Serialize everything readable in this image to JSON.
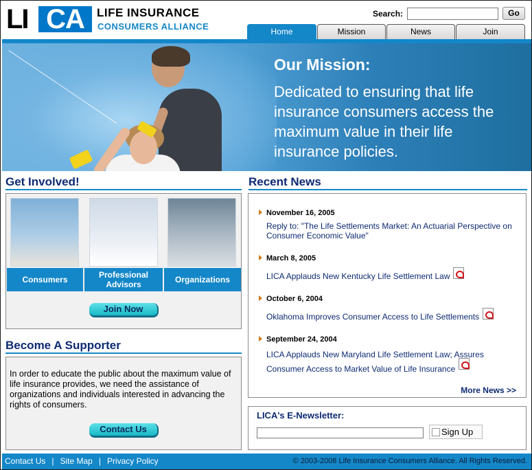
{
  "header": {
    "logo_left": "LI",
    "logo_right": "CA",
    "brand_line1": "LIFE INSURANCE",
    "brand_line2": "CONSUMERS ALLIANCE",
    "search_label": "Search:",
    "search_value": "",
    "go_label": "Go"
  },
  "tabs": [
    {
      "label": "Home",
      "active": true
    },
    {
      "label": "Mission",
      "active": false
    },
    {
      "label": "News",
      "active": false
    },
    {
      "label": "Join",
      "active": false
    }
  ],
  "hero": {
    "title": "Our Mission:",
    "text": "Dedicated to ensuring that life insurance consumers access the maximum value in their life insurance policies."
  },
  "get_involved": {
    "heading": "Get Involved!",
    "cells": [
      "Consumers",
      "Professional Advisors",
      "Organizations"
    ],
    "button": "Join Now"
  },
  "supporter": {
    "heading": "Become A Supporter",
    "text": "In order to educate the public about the maximum value of life insurance provides, we need the assistance of organizations and individuals interested in advancing the rights of consumers.",
    "button": "Contact Us"
  },
  "news": {
    "heading": "Recent News",
    "items": [
      {
        "date": "November 16, 2005",
        "title": "Reply to: \"The Life Settlements Market: An Actuarial Perspective on Consumer Economic Value\"",
        "pdf": false
      },
      {
        "date": "March 8, 2005",
        "title": "LICA Applauds New Kentucky Life Settlement Law",
        "pdf": true
      },
      {
        "date": "October 6, 2004",
        "title": "Oklahoma Improves Consumer Access to Life Settlements",
        "pdf": true
      },
      {
        "date": "September 24, 2004",
        "title": "LICA Applauds New Maryland Life Settlement Law; Assures Consumer Access to Market Value of Life Insurance",
        "pdf": true
      }
    ],
    "more": "More News >>"
  },
  "newsletter": {
    "title": "LICA's E-Newsletter:",
    "email_value": "",
    "signup": "Sign Up"
  },
  "footer": {
    "links": [
      "Contact Us",
      "Site Map",
      "Privacy Policy"
    ],
    "copyright": "© 2003-2008 Life Insurance Consumers Alliance. All Rights Reserved."
  },
  "colors": {
    "accent": "#1487c9",
    "heading": "#0d2a72",
    "button": "#18b9c6"
  }
}
